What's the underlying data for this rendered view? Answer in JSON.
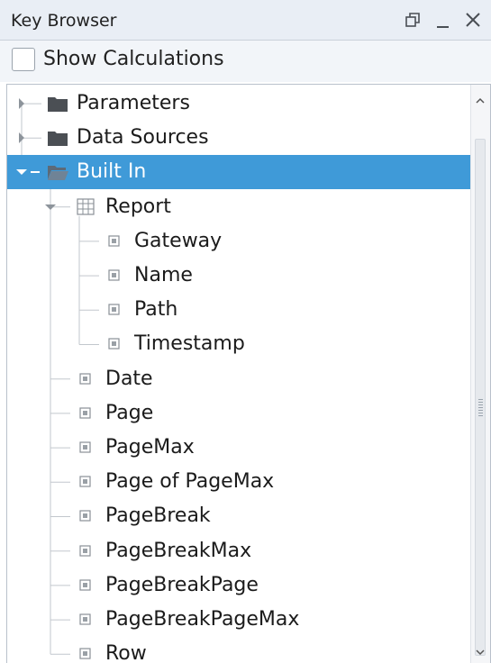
{
  "window": {
    "title": "Key Browser",
    "buttons": [
      "restore-icon",
      "minimize-icon",
      "close-icon"
    ]
  },
  "options": {
    "show_calculations_label": "Show Calculations",
    "show_calculations_checked": false
  },
  "tree": {
    "items": [
      {
        "label": "Parameters",
        "icon": "folder-icon",
        "expanded": false
      },
      {
        "label": "Data Sources",
        "icon": "folder-icon",
        "expanded": false
      },
      {
        "label": "Built In",
        "icon": "folder-open-icon",
        "expanded": true,
        "selected": true
      },
      {
        "label": "Report",
        "icon": "table-icon",
        "expanded": true
      },
      {
        "label": "Gateway",
        "icon": "key-icon"
      },
      {
        "label": "Name",
        "icon": "key-icon"
      },
      {
        "label": "Path",
        "icon": "key-icon"
      },
      {
        "label": "Timestamp",
        "icon": "key-icon"
      },
      {
        "label": "Date",
        "icon": "key-icon"
      },
      {
        "label": "Page",
        "icon": "key-icon"
      },
      {
        "label": "PageMax",
        "icon": "key-icon"
      },
      {
        "label": "Page of PageMax",
        "icon": "key-icon"
      },
      {
        "label": "PageBreak",
        "icon": "key-icon"
      },
      {
        "label": "PageBreakMax",
        "icon": "key-icon"
      },
      {
        "label": "PageBreakPage",
        "icon": "key-icon"
      },
      {
        "label": "PageBreakPageMax",
        "icon": "key-icon"
      },
      {
        "label": "Row",
        "icon": "key-icon"
      }
    ]
  },
  "colors": {
    "selection": "#3f9ad8",
    "folder": "#4b4f54",
    "titlebar": "#e9eef5"
  }
}
